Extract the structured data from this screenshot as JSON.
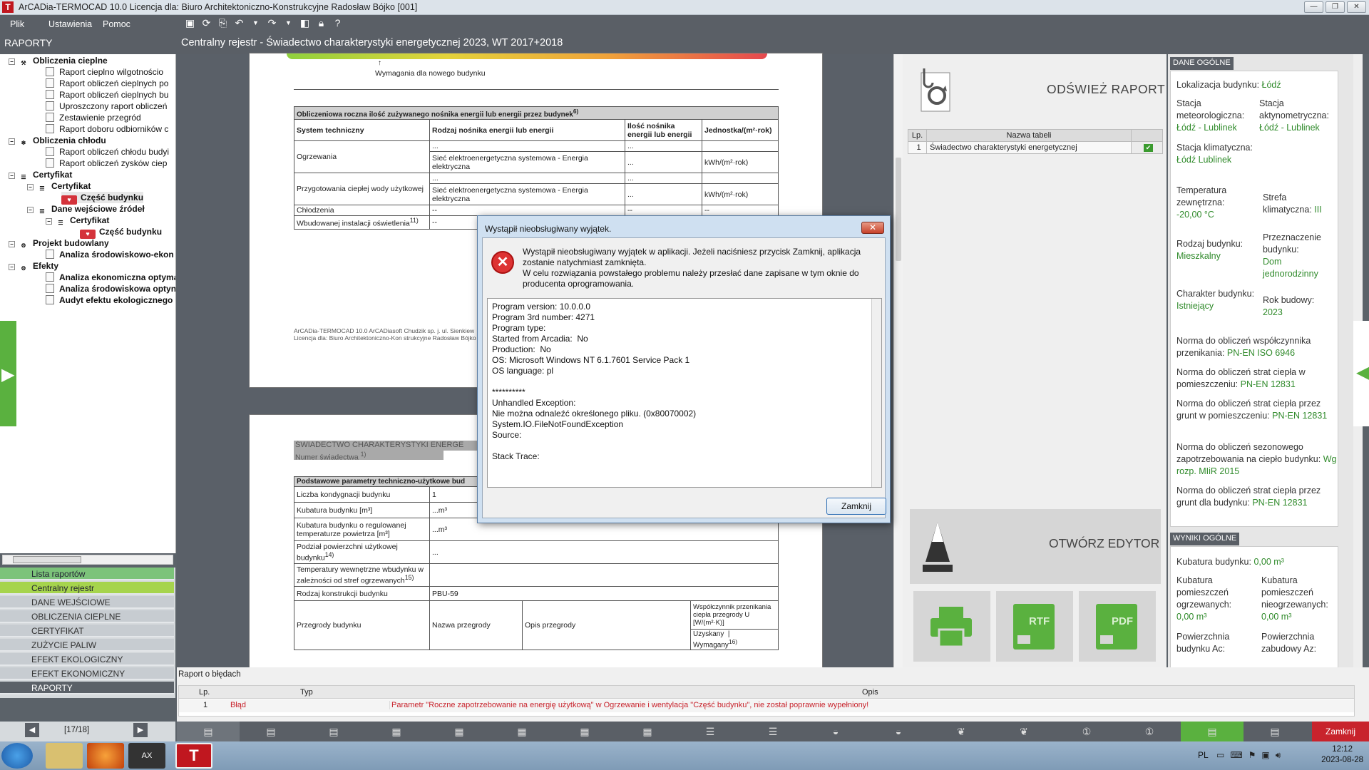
{
  "window": {
    "title": "ArCADia-TERMOCAD 10.0 Licencja dla: Biuro Architektoniczno-Konstrukcyjne Radosław Bójko [001]"
  },
  "menu": [
    "Plik",
    "Ustawienia",
    "Pomoc"
  ],
  "sidebar_title": "RAPORTY",
  "doc_title": "Centralny rejestr - Świadectwo charakterystyki energetycznej 2023, WT 2017+2018",
  "tree": [
    "Obliczenia cieplne",
    "Raport cieplno wilgotnościo",
    "Raport obliczeń cieplnych po",
    "Raport obliczeń cieplnych bu",
    "Uproszczony raport obliczeń",
    "Zestawienie przegród",
    "Raport doboru odbiorników c",
    "Obliczenia chłodu",
    "Raport obliczeń chłodu budyi",
    "Raport obliczeń zysków ciep",
    "Certyfikat",
    "Certyfikat",
    "Część budynku",
    "Dane wejściowe źródeł",
    "Certyfikat",
    "Część budynku",
    "Projekt budowlany",
    "Analiza środowiskowo-ekon",
    "Efekty",
    "Analiza ekonomiczna optyma",
    "Analiza środowiskowa optyn",
    "Audyt efektu ekologicznego"
  ],
  "leftnav": [
    "Lista raportów",
    "Centralny rejestr",
    "DANE WEJŚCIOWE",
    "OBLICZENIA CIEPLNE",
    "CERTYFIKAT",
    "ZUŻYCIE PALIW",
    "EFEKT EKOLOGICZNY",
    "EFEKT EKONOMICZNY",
    "RAPORTY"
  ],
  "pager": "[17/18]",
  "page1": {
    "req_label": "Wymagania dla nowego budynku",
    "table_title": "Obliczeniowa roczna ilość zużywanego nośnika energii lub energii przez budynek",
    "table_title_sup": "6)",
    "cols": [
      "System techniczny",
      "Rodzaj nośnika energii lub energii",
      "Ilość nośnika energii lub energii",
      "Jednostka/(m²·rok)"
    ],
    "rows": [
      {
        "sys": "Ogrzewania",
        "carrier": "...",
        "qty": "...",
        "unit": ""
      },
      {
        "sys": "",
        "carrier": "Sieć elektroenergetyczna systemowa - Energia elektryczna",
        "qty": "...",
        "unit": "kWh/(m²·rok)"
      },
      {
        "sys": "Przygotowania ciepłej wody użytkowej",
        "carrier": "...",
        "qty": "...",
        "unit": ""
      },
      {
        "sys": "",
        "carrier": "Sieć elektroenergetyczna systemowa - Energia elektryczna",
        "qty": "...",
        "unit": "kWh/(m²·rok)"
      },
      {
        "sys": "Chłodzenia",
        "carrier": "--",
        "qty": "--",
        "unit": "--"
      },
      {
        "sys": "Wbudowanej instalacji oświetlenia",
        "sys_sup": "11)",
        "carrier": "--",
        "qty": "",
        "unit": ""
      }
    ],
    "footer1": "ArCADia-TERMOCAD 10.0 ArCADiasoft Chudzik sp. j. ul. Sienkiew",
    "footer2": "Licencja dla: Biuro Architektoniczno-Kon strukcyjne Radosław Bójko [00"
  },
  "page2": {
    "cert_title": "ŚWIADECTWO CHARAKTERYSTYKI ENERGE",
    "cert_num": "Numer świadectwa",
    "cert_num_sup": "1)",
    "params_title": "Podstawowe parametry techniczno-użytkowe bud",
    "rows": [
      {
        "k": "Liczba kondygnacji budynku",
        "v": "1"
      },
      {
        "k": "Kubatura budynku [m³]",
        "v": "...m³"
      },
      {
        "k": "Kubatura budynku o regulowanej temperaturze powietrza [m³]",
        "v": "...m³"
      },
      {
        "k": "Podział powierzchni użytkowej budynku",
        "k_sup": "14)",
        "v": "..."
      },
      {
        "k": "Temperatury wewnętrzne wbudynku w zależności od stref ogrzewanych",
        "k_sup": "15)",
        "v": ""
      },
      {
        "k": "Rodzaj konstrukcji budynku",
        "v": "PBU-59"
      }
    ],
    "partitions": "Przegrody budynku",
    "p_name": "Nazwa przegrody",
    "p_desc": "Opis przegrody",
    "p_u": "Współczynnik przenikania ciepła przegrody U [W/(m²·K)]",
    "p_got": "Uzyskany",
    "p_req": "Wymagany",
    "p_req_sup": "16)"
  },
  "right": {
    "refresh": "ODŚWIEŻ RAPORT",
    "tbl_cols": [
      "Lp.",
      "Nazwa tabeli"
    ],
    "tbl_row": {
      "lp": "1",
      "name": "Świadectwo charakterystyki energetycznej",
      "check": "✔"
    },
    "open_editor": "OTWÓRZ EDYTOR",
    "export": [
      "RTF",
      "PDF"
    ]
  },
  "general": {
    "header": "DANE OGÓLNE",
    "location_label": "Lokalizacja budynku:",
    "location": "Łódź",
    "met_label": "Stacja meteorologiczna:",
    "met": "Łódź - Lublinek",
    "act_label": "Stacja aktynometryczna:",
    "act": "Łódź - Lublinek",
    "clim_label": "Stacja klimatyczna:",
    "clim": "Łódź Lublinek",
    "temp_label": "Temperatura zewnętrzna:",
    "temp": "-20,00 °C",
    "zone_label": "Strefa klimatyczna:",
    "zone": "III",
    "type_label": "Rodzaj budynku:",
    "type": "Mieszkalny",
    "purpose_label": "Przeznaczenie budynku:",
    "purpose": "Dom jednorodzinny",
    "char_label": "Charakter budynku:",
    "char": "Istniejący",
    "year_label": "Rok budowy:",
    "year": "2023",
    "n1_label": "Norma do obliczeń współczynnika przenikania:",
    "n1": "PN-EN ISO 6946",
    "n2_label": "Norma do obliczeń strat ciepła w pomieszczeniu:",
    "n2": "PN-EN 12831",
    "n3_label": "Norma do obliczeń strat ciepła przez grunt w pomieszczeniu:",
    "n3": "PN-EN 12831",
    "n4_label": "Norma do obliczeń sezonowego zapotrzebowania na ciepło budynku:",
    "n4": "Wg rozp. MIiR 2015",
    "n5_label": "Norma do obliczeń strat ciepła przez grunt dla budynku:",
    "n5": "PN-EN 12831"
  },
  "results": {
    "header": "WYNIKI OGÓLNE",
    "vol_label": "Kubatura budynku:",
    "vol": "0,00 m³",
    "vh_label": "Kubatura pomieszczeń ogrzewanych:",
    "vh": "0,00 m³",
    "vn_label": "Kubatura pomieszczeń nieogrzewanych:",
    "vn": "0,00 m³",
    "ac_label": "Powierzchnia budynku Ac:",
    "az_label": "Powierzchnia zabudowy Az:"
  },
  "errors": {
    "title": "Raport o błędach",
    "cols": [
      "Lp.",
      "Typ",
      "Opis"
    ],
    "row": {
      "lp": "1",
      "type": "Błąd",
      "desc": "Parametr \"Roczne zapotrzebowanie na energię użytkową\" w Ogrzewanie i wentylacja \"Część budynku\", nie został poprawnie wypełniony!"
    }
  },
  "close_label": "Zamknij",
  "dialog": {
    "title": "Wystąpił nieobsługiwany wyjątek.",
    "msg": "Wystąpił nieobsługiwany wyjątek w aplikacji. Jeżeli naciśniesz przycisk Zamknij, aplikacja zostanie natychmiast zamknięta.\nW celu rozwiązania powstałego problemu należy przesłać dane zapisane w tym oknie do producenta oprogramowania.",
    "details": "Program version: 10.0.0.0\nProgram 3rd number: 4271\nProgram type:\nStarted from Arcadia:  No\nProduction:  No\nOS: Microsoft Windows NT 6.1.7601 Service Pack 1\nOS language: pl\n\n**********\nUnhandled Exception:\nNie można odnaleźć określonego pliku. (0x80070002)\nSystem.IO.FileNotFoundException\nSource:\n\nStack Trace:",
    "button": "Zamknij"
  },
  "taskbar": {
    "lang": "PL",
    "time": "12:12",
    "date": "2023-08-28"
  },
  "colors": {
    "accent_green": "#5ab13f",
    "dark": "#5a5f66",
    "error_red": "#c8232c",
    "link_green": "#2f8a2a"
  }
}
